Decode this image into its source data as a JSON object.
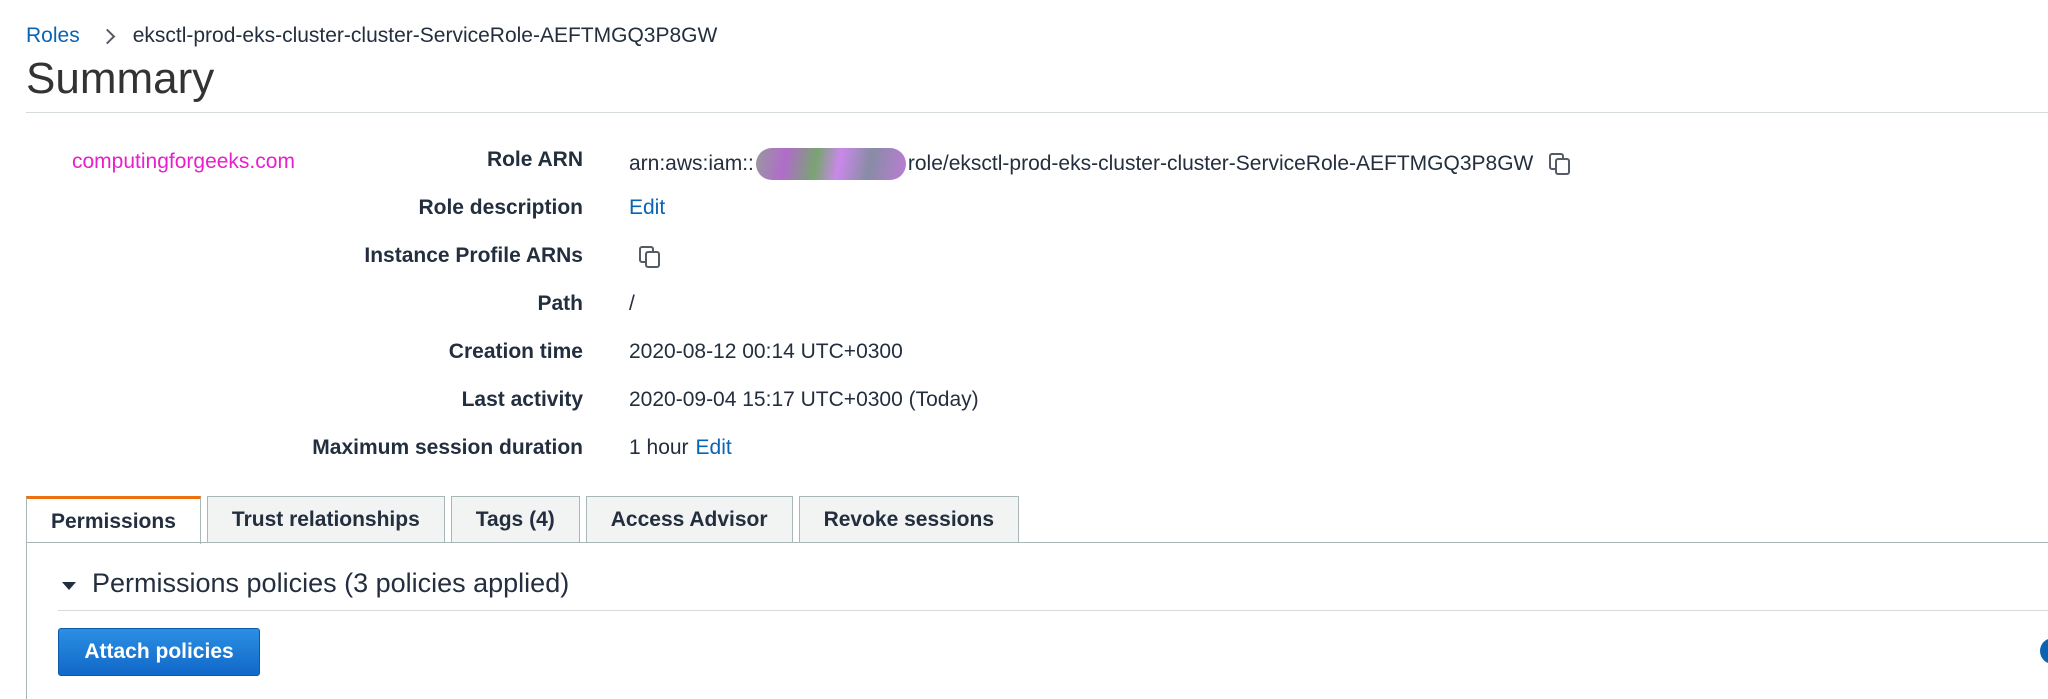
{
  "breadcrumb": {
    "parent": "Roles",
    "current": "eksctl-prod-eks-cluster-cluster-ServiceRole-AEFTMGQ3P8GW"
  },
  "page_title": "Summary",
  "watermark": "computingforgeeks.com",
  "summary": {
    "role_arn_label": "Role ARN",
    "role_arn_prefix": "arn:aws:iam::",
    "role_arn_suffix": "role/eksctl-prod-eks-cluster-cluster-ServiceRole-AEFTMGQ3P8GW",
    "role_description_label": "Role description",
    "role_description_edit": "Edit",
    "instance_profile_label": "Instance Profile ARNs",
    "path_label": "Path",
    "path_value": "/",
    "creation_time_label": "Creation time",
    "creation_time_value": "2020-08-12 00:14 UTC+0300",
    "last_activity_label": "Last activity",
    "last_activity_value": "2020-09-04 15:17 UTC+0300 (Today)",
    "max_session_label": "Maximum session duration",
    "max_session_value": "1 hour",
    "max_session_edit": "Edit"
  },
  "tabs": [
    {
      "label": "Permissions",
      "active": true
    },
    {
      "label": "Trust relationships",
      "active": false
    },
    {
      "label": "Tags (4)",
      "active": false
    },
    {
      "label": "Access Advisor",
      "active": false
    },
    {
      "label": "Revoke sessions",
      "active": false
    }
  ],
  "permissions": {
    "section_title": "Permissions policies (3 policies applied)",
    "attach_button": "Attach policies"
  },
  "colors": {
    "link": "#0a64b4",
    "active_tab_accent": "#ec7211",
    "primary_button": "#1a73d2",
    "watermark": "#e81fcb"
  },
  "icons": {
    "copy": "copy-icon",
    "caret": "caret-down-icon",
    "separator": "chevron-right-icon",
    "help": "info-icon"
  }
}
